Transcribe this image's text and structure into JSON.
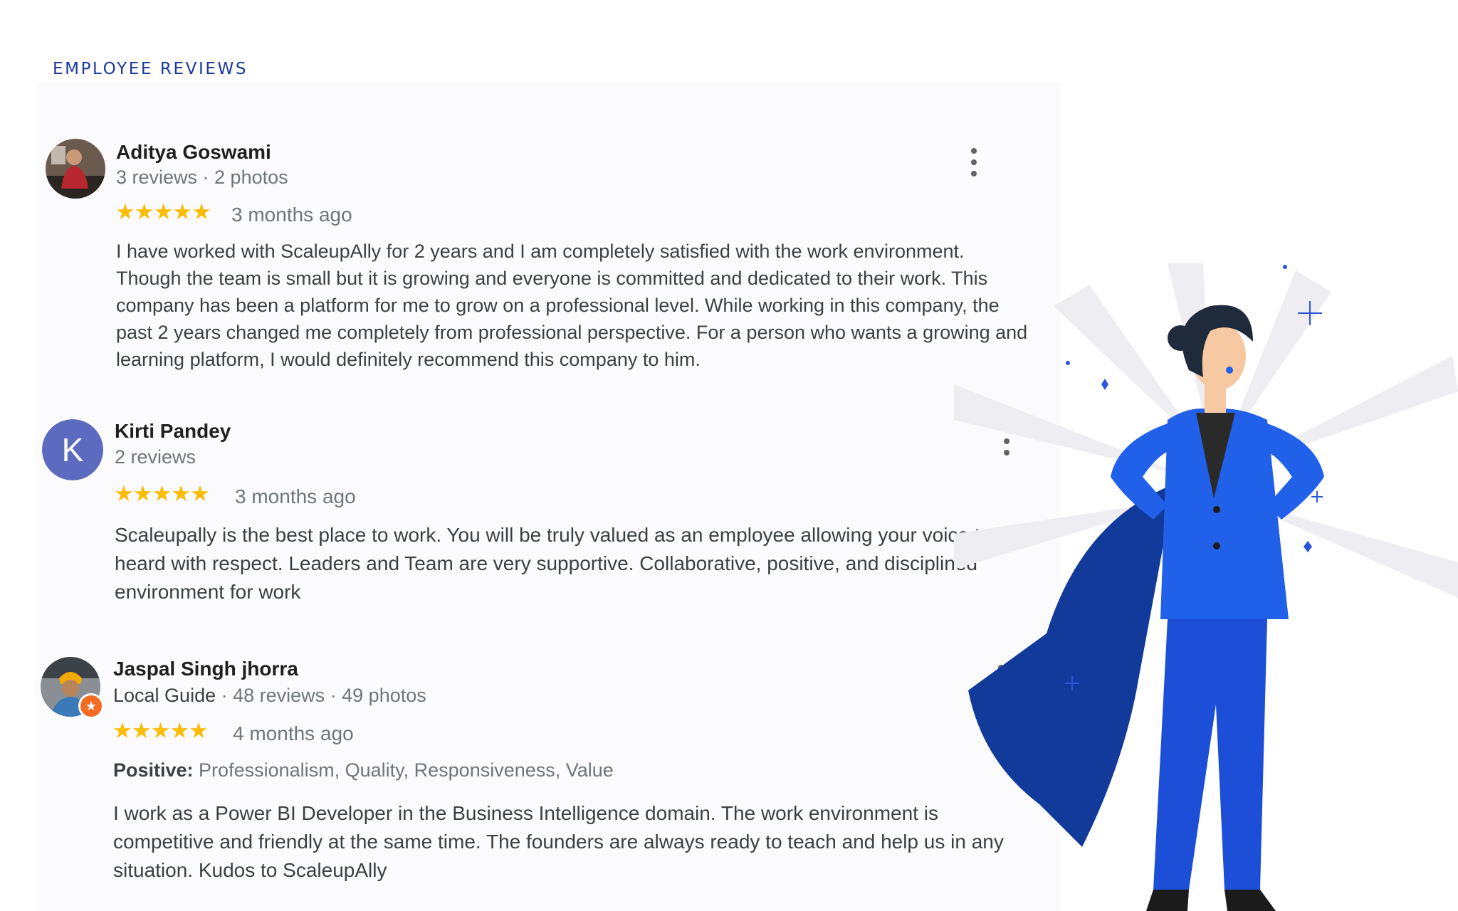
{
  "section": {
    "title": "EMPLOYEE REVIEWS"
  },
  "reviews": [
    {
      "name": "Aditya Goswami",
      "meta": "3 reviews · 2 photos",
      "stars": "★★★★★",
      "rating": 5,
      "time": "3 months ago",
      "text": "I have worked with ScaleupAlly for 2 years and I am completely satisfied with the work environment. Though the team is small but it is growing and everyone is committed and dedicated to their work. This company has been a platform for me to grow on a professional level. While working in this company, the past 2 years changed me completely from professional perspective. For a person who wants a growing and learning platform, I would definitely recommend this company to him."
    },
    {
      "name": "Kirti Pandey",
      "avatar_letter": "K",
      "meta": "2 reviews",
      "stars": "★★★★★",
      "rating": 5,
      "time": "3 months ago",
      "text": "Scaleupally is the best place to work. You will be truly valued as an employee allowing your voice to be heard with respect. Leaders and Team are very supportive. Collaborative, positive, and disciplined environment for work"
    },
    {
      "name": "Jaspal Singh jhorra",
      "badge": "Local Guide",
      "meta": " · 48 reviews · 49 photos",
      "stars": "★★★★★",
      "rating": 5,
      "time": "4 months ago",
      "positive_label": "Positive:",
      "positive_items": " Professionalism, Quality, Responsiveness, Value",
      "text": "I work as a Power BI Developer in the Business Intelligence domain. The work environment is competitive and friendly at the same time. The founders are always ready to teach and help us in any situation. Kudos to ScaleupAlly"
    }
  ],
  "colors": {
    "title": "#1a3a9c",
    "star": "#fbbc04",
    "avatar_k": "#5c6bc0",
    "suit": "#1d4ed8",
    "cape": "#123a9a"
  },
  "icons": [
    "more-vert-icon",
    "local-guide-badge-icon",
    "sparkle-icon"
  ]
}
